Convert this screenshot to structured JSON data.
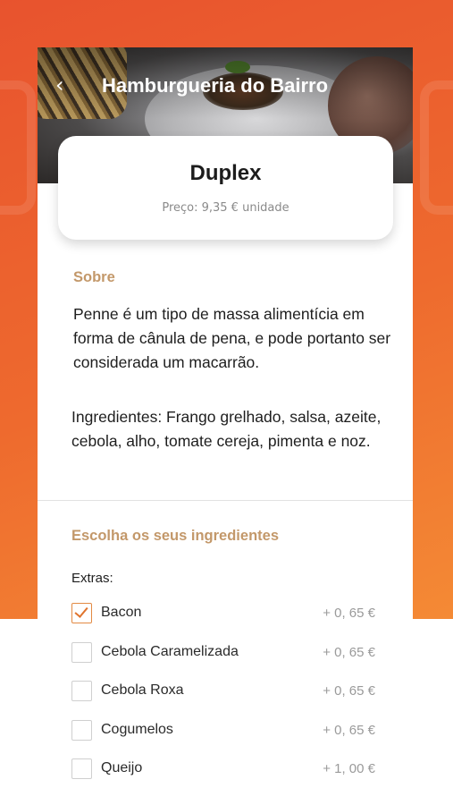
{
  "header": {
    "back_icon": "chevron-left-icon",
    "back_glyph": "‹",
    "title": "Hamburgueria do Bairro"
  },
  "product": {
    "name": "Duplex",
    "price_text": "Preço: 9,35 € unidade"
  },
  "about": {
    "title": "Sobre",
    "description": "Penne é um tipo de massa alimentícia em forma de cânula de pena, e pode portanto ser considerada um macarrão.",
    "ingredients": "Ingredientes: Frango grelhado, salsa, azeite, cebola, alho, tomate cereja, pimenta e noz."
  },
  "customize": {
    "title": "Escolha os seus ingredientes",
    "extras_label": "Extras:",
    "options": [
      {
        "name": "Bacon",
        "price": "+ 0, 65 €",
        "checked": true
      },
      {
        "name": "Cebola Caramelizada",
        "price": "+ 0, 65 €",
        "checked": false
      },
      {
        "name": "Cebola Roxa",
        "price": "+ 0, 65 €",
        "checked": false
      },
      {
        "name": "Cogumelos",
        "price": "+ 0, 65 €",
        "checked": false
      },
      {
        "name": "Queijo",
        "price": "+ 1, 00 €",
        "checked": false
      }
    ]
  },
  "colors": {
    "brand_orange": "#ec5f2f",
    "accent_gold": "#c3986a",
    "check_orange": "#e0742d"
  }
}
